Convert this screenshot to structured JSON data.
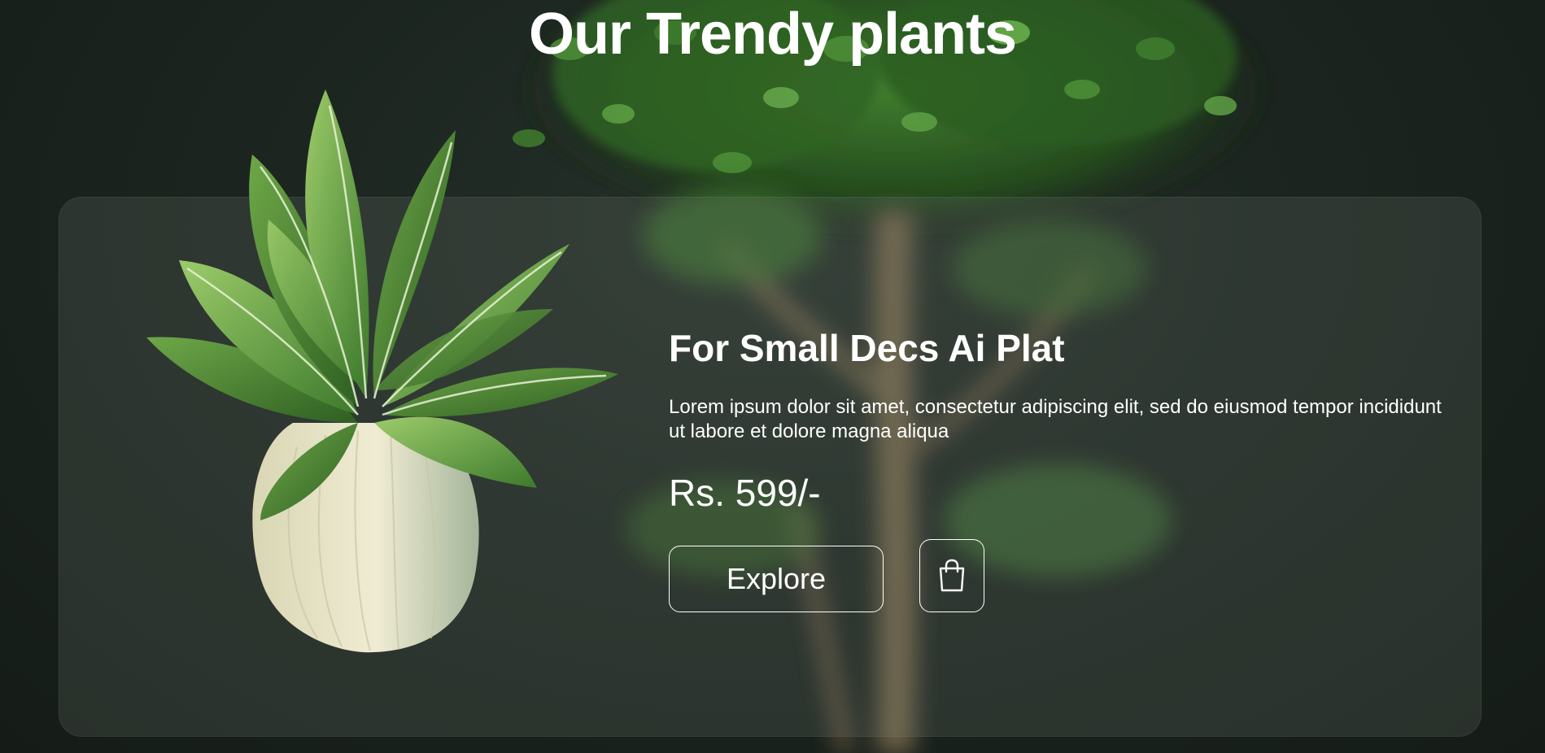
{
  "header": {
    "title": "Our Trendy plants"
  },
  "product": {
    "name": "For Small Decs Ai Plat",
    "description": "Lorem ipsum dolor sit amet, consectetur adipiscing elit, sed do eiusmod tempor incididunt ut labore et dolore magna aliqua",
    "price": "Rs. 599/-",
    "explore_label": "Explore",
    "cart_icon": "shopping-bag-icon"
  },
  "colors": {
    "background": "#1c2520",
    "card": "#3a4139",
    "text": "#ffffff",
    "leaf": "#4f8f3a"
  }
}
